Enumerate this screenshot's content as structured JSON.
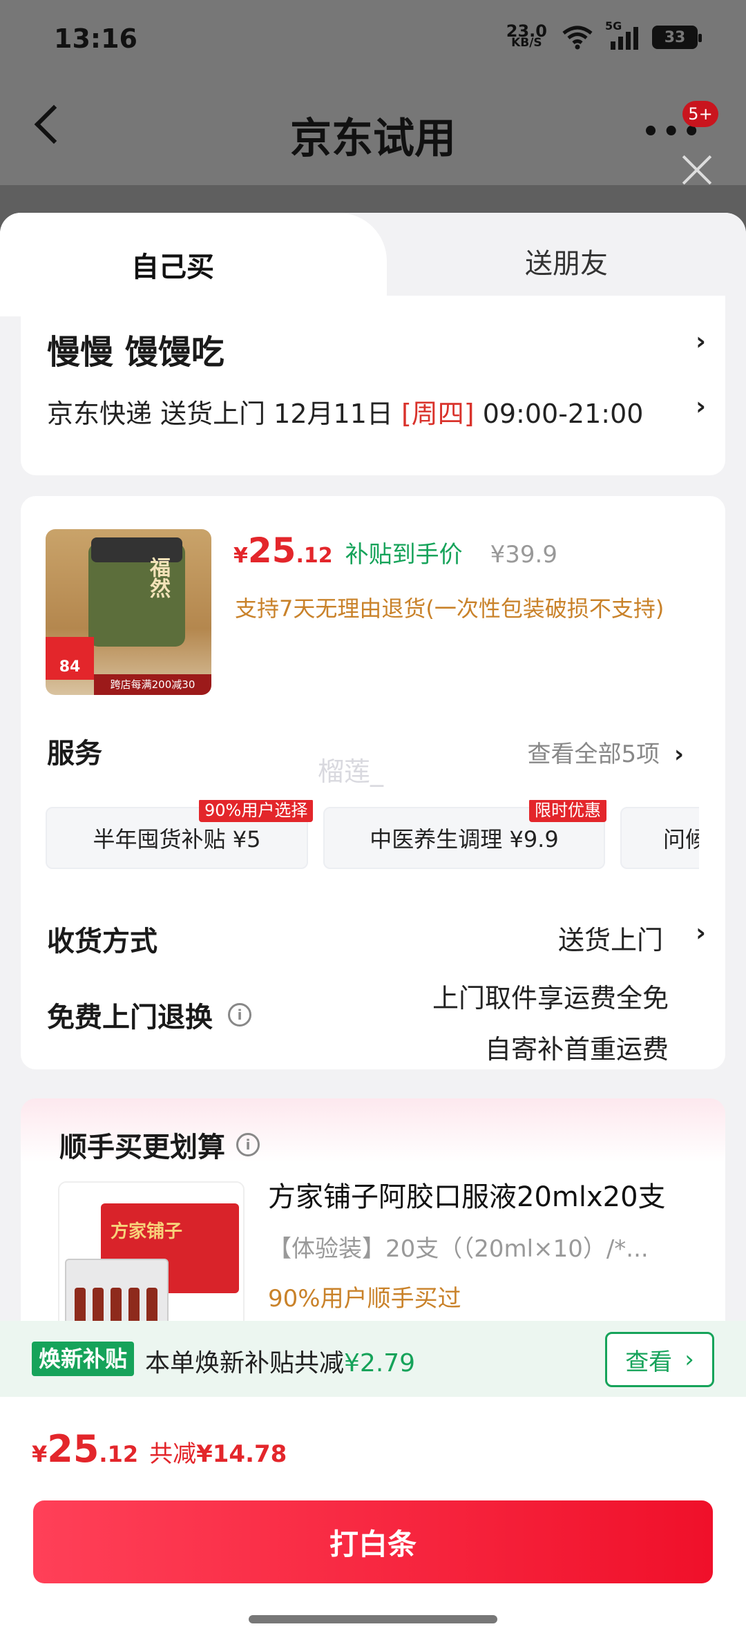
{
  "status_bar": {
    "time": "13:16",
    "net_speed_value": "23.0",
    "net_speed_unit": "KB/S",
    "signal": "5G",
    "battery": "33"
  },
  "nav": {
    "title": "京东试用",
    "more": "•••",
    "badge": "5+"
  },
  "tabs": {
    "own": "自己买",
    "friend": "送朋友"
  },
  "address": {
    "name": "慢慢  馒馒吃",
    "delivery_prefix": "京东快递 送货上门 12月11日 ",
    "delivery_day": "[周四]",
    "delivery_time": " 09:00-21:00"
  },
  "product": {
    "thumb_brand": "福然",
    "thumb_tag": "84",
    "thumb_strip": "跨店每满200减30",
    "price_symbol": "¥",
    "price_int": "25",
    "price_dec": ".12",
    "subsidy_label": "补贴到手价",
    "original_price": "¥39.9",
    "refund_policy": "支持7天无理由退货(一次性包装破损不支持)"
  },
  "services": {
    "title": "服务",
    "view_all": "查看全部5项",
    "watermark": "榴莲_",
    "items": [
      {
        "label": "半年囤货补贴  ¥5",
        "badge": "90%用户选择"
      },
      {
        "label": "中医养生调理  ¥9.9",
        "badge": "限时优惠"
      },
      {
        "label": "问候",
        "badge": ""
      }
    ]
  },
  "receive": {
    "title": "收货方式",
    "value": "送货上门"
  },
  "returns": {
    "title": "免费上门退换",
    "line1": "上门取件享运费全免",
    "line2": "自寄补首重运费"
  },
  "addon": {
    "title": "顺手买更划算",
    "box_label": "方家铺子",
    "name": "方家铺子阿胶口服液20mlx20支",
    "spec": "【体验装】20支（（20ml×10）/*...",
    "note": "90%用户顺手买过"
  },
  "subsidy_bar": {
    "tag": "焕新补贴",
    "text": "本单焕新补贴共减",
    "amount": "¥2.79",
    "button": "查看"
  },
  "checkout": {
    "symbol": "¥",
    "int": "25",
    "dec": ".12",
    "saved_label": "共减",
    "saved_amount": "¥14.78",
    "button": "打白条"
  },
  "colors": {
    "accent_red": "#e3262b",
    "subsidy_green": "#16a35a",
    "refund_orange": "#c9822a"
  }
}
